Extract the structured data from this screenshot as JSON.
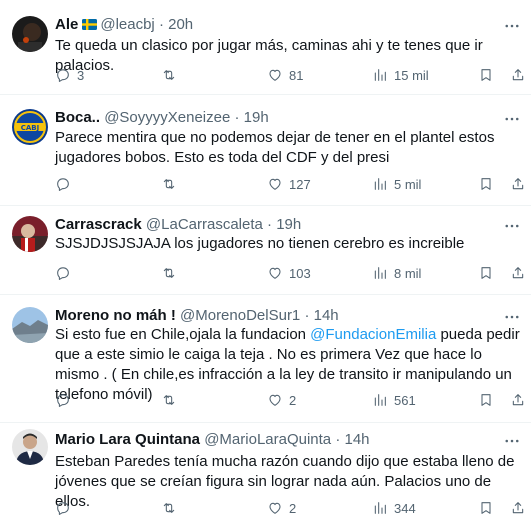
{
  "tweets": [
    {
      "name": "Ale",
      "handle": "@leacbj",
      "time": "20h",
      "has_flag": true,
      "body": "Te queda un clasico por jugar más, caminas ahi y te tenes que ir palacios.",
      "replies": "3",
      "retweets": "",
      "likes": "81",
      "views": "15 mil"
    },
    {
      "name": "Boca..",
      "handle": "@SoyyyyXeneizee",
      "time": "19h",
      "body": "Parece mentira que no podemos dejar de tener en el plantel estos jugadores bobos. Esto es toda del CDF y del presi",
      "replies": "",
      "retweets": "",
      "likes": "127",
      "views": "5 mil"
    },
    {
      "name": "Carrascrack",
      "handle": "@LaCarrascaleta",
      "time": "19h",
      "body": "SJSJDJSJSJAJA los jugadores no tienen cerebro es increible",
      "replies": "",
      "retweets": "",
      "likes": "103",
      "views": "8 mil"
    },
    {
      "name": "Moreno no máh !",
      "handle": "@MorenoDelSur1",
      "time": "14h",
      "body_before": "Si esto fue en Chile,ojala la fundacion ",
      "mention": "@FundacionEmilia",
      "body_after": " pueda pedir que a este simio le caiga la teja . No es primera Vez que hace lo mismo . ( En chile,es infracción a la ley de transito ir manipulando un telefono móvil)",
      "replies": "",
      "retweets": "",
      "likes": "2",
      "views": "561"
    },
    {
      "name": "Mario Lara Quintana",
      "handle": "@MarioLaraQuinta",
      "time": "14h",
      "body": "Esteban Paredes tenía mucha razón cuando dijo que estaba lleno de jóvenes que se creían figura sin lograr nada aún. Palacios uno de ellos.",
      "replies": "",
      "retweets": "",
      "likes": "2",
      "views": "344"
    }
  ],
  "separator": "·",
  "icons": {
    "reply": "reply-icon",
    "retweet": "retweet-icon",
    "like": "heart-icon",
    "views": "views-chart-icon",
    "bookmark": "bookmark-icon",
    "share": "share-icon",
    "more": "more-dots-icon"
  },
  "colors": {
    "text": "#0f1419",
    "secondary": "#536471",
    "link": "#1d9bf0",
    "divider": "#eff3f4"
  }
}
